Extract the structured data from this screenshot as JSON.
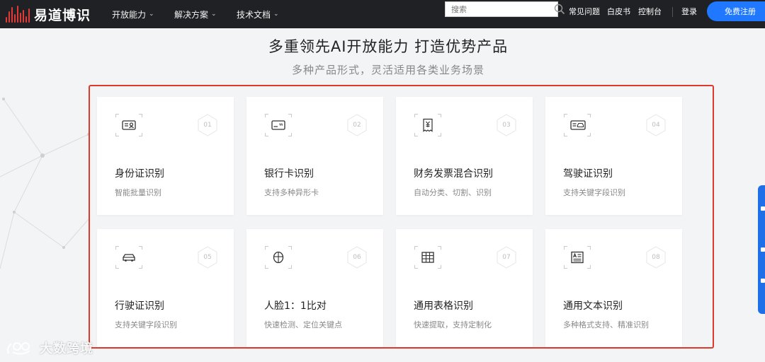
{
  "brand": {
    "name": "易道博识",
    "logo_icon": "sound-bars-logo-icon"
  },
  "nav": [
    {
      "label": "开放能力",
      "icon": "chevron-down-icon"
    },
    {
      "label": "解决方案",
      "icon": "chevron-down-icon"
    },
    {
      "label": "技术文档",
      "icon": "chevron-down-icon"
    }
  ],
  "search": {
    "placeholder": "搜索",
    "icon": "search-icon"
  },
  "top_links": {
    "faq": "常见问题",
    "whitepaper": "白皮书",
    "console": "控制台",
    "login": "登录",
    "register": "免费注册"
  },
  "section": {
    "title": "多重领先AI开放能力  打造优势产品",
    "subtitle": "多种产品形式，灵活适用各类业务场景"
  },
  "cards": [
    {
      "num": "01",
      "title": "身份证识别",
      "desc": "智能批量识别",
      "icon": "id-card-icon"
    },
    {
      "num": "02",
      "title": "银行卡识别",
      "desc": "支持多种异形卡",
      "icon": "bank-card-icon"
    },
    {
      "num": "03",
      "title": "财务发票混合识别",
      "desc": "自动分类、切割、识别",
      "icon": "invoice-icon"
    },
    {
      "num": "04",
      "title": "驾驶证识别",
      "desc": "支持关键字段识别",
      "icon": "driver-license-icon"
    },
    {
      "num": "05",
      "title": "行驶证识别",
      "desc": "支持关键字段识别",
      "icon": "car-icon"
    },
    {
      "num": "06",
      "title": "人脸1：1比对",
      "desc": "快速检测、定位关键点",
      "icon": "face-icon"
    },
    {
      "num": "07",
      "title": "通用表格识别",
      "desc": "快速提取，支持定制化",
      "icon": "table-icon"
    },
    {
      "num": "08",
      "title": "通用文本识别",
      "desc": "多种格式支持、精准识别",
      "icon": "text-document-icon"
    }
  ],
  "watermark": {
    "text": "大数跨境",
    "icon": "watermark-logo-icon"
  },
  "colors": {
    "topbar": "#1f2124",
    "accent_red": "#e0382b",
    "primary_blue": "#1f78ff",
    "page_bg": "#f3f4f6"
  }
}
